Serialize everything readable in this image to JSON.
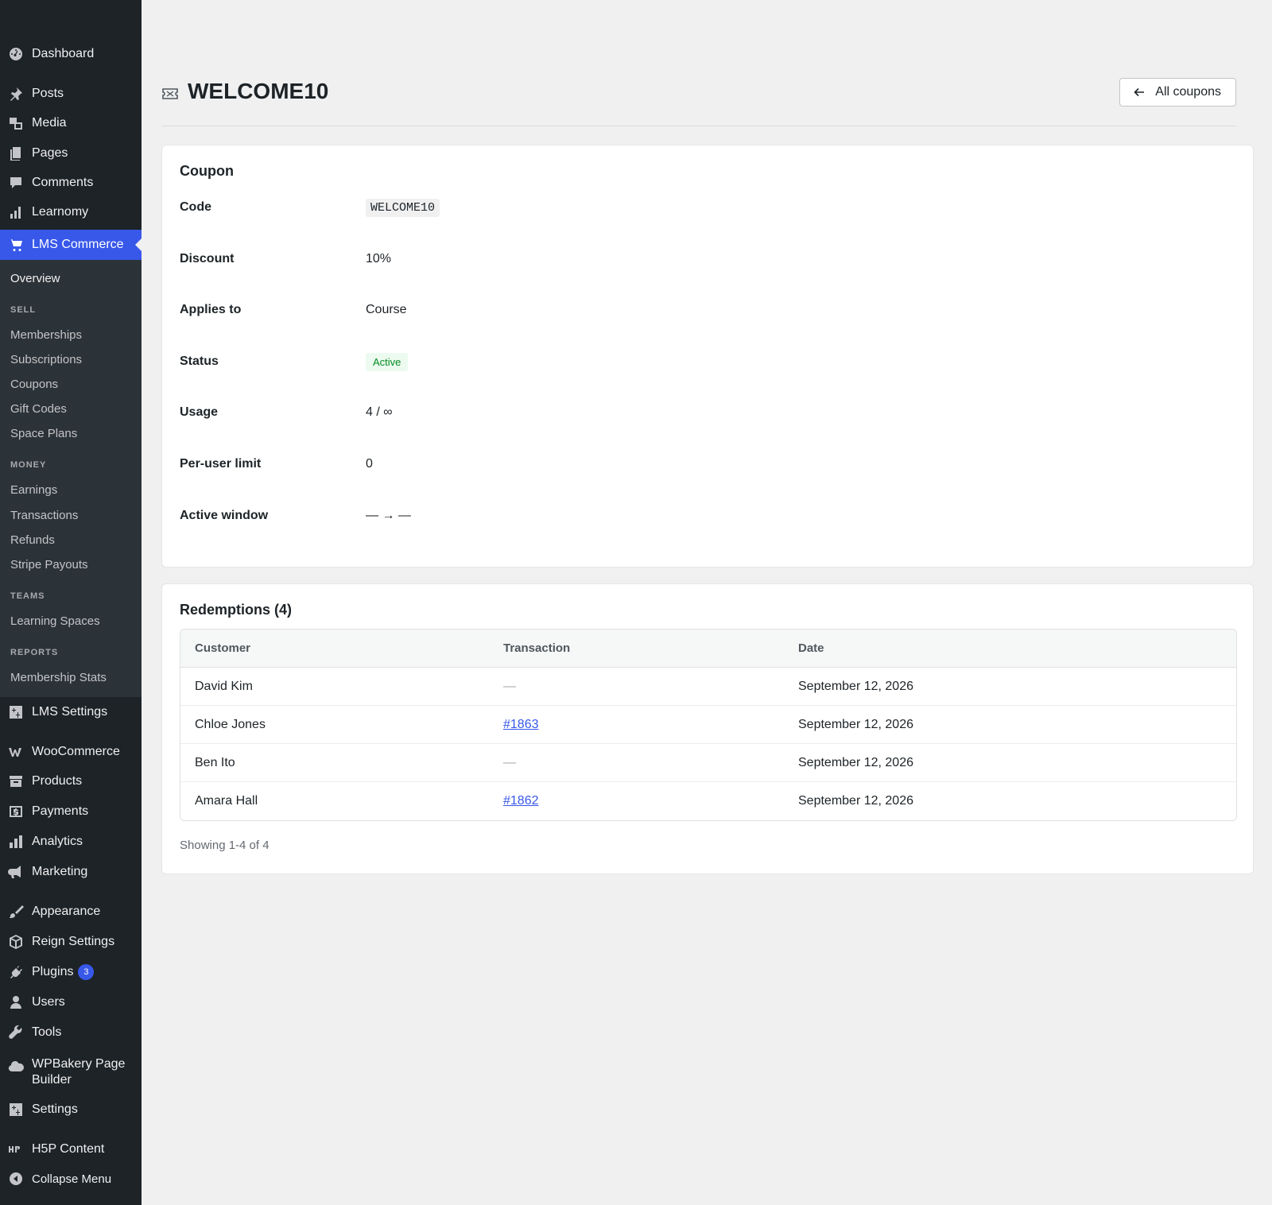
{
  "sidebar": {
    "menu": [
      {
        "label": "Dashboard",
        "icon": "dashboard-icon"
      },
      {
        "label": "Posts",
        "icon": "pin-icon"
      },
      {
        "label": "Media",
        "icon": "media-icon"
      },
      {
        "label": "Pages",
        "icon": "pages-icon"
      },
      {
        "label": "Comments",
        "icon": "comment-icon"
      },
      {
        "label": "Learnomy",
        "icon": "bar-chart-icon"
      },
      {
        "label": "LMS Commerce",
        "icon": "cart-icon"
      },
      {
        "label": "LMS Settings",
        "icon": "settings-icon"
      },
      {
        "label": "WooCommerce",
        "icon": "woocommerce-icon"
      },
      {
        "label": "Products",
        "icon": "archive-icon"
      },
      {
        "label": "Payments",
        "icon": "dollar-icon"
      },
      {
        "label": "Analytics",
        "icon": "bar-chart-icon"
      },
      {
        "label": "Marketing",
        "icon": "megaphone-icon"
      },
      {
        "label": "Appearance",
        "icon": "brush-icon"
      },
      {
        "label": "Reign Settings",
        "icon": "cube-icon"
      },
      {
        "label": "Plugins",
        "icon": "plugin-icon",
        "badge": "3"
      },
      {
        "label": "Users",
        "icon": "user-icon"
      },
      {
        "label": "Tools",
        "icon": "wrench-icon"
      },
      {
        "label": "WPBakery Page Builder",
        "icon": "cloud-icon"
      },
      {
        "label": "Settings",
        "icon": "settings-icon"
      },
      {
        "label": "H5P Content",
        "icon": "h5p-icon"
      },
      {
        "label": "Collapse Menu",
        "icon": "collapse-icon"
      }
    ],
    "submenu": {
      "overview": "Overview",
      "sell_heading": "SELL",
      "sell": [
        "Memberships",
        "Subscriptions",
        "Coupons",
        "Gift Codes",
        "Space Plans"
      ],
      "money_heading": "MONEY",
      "money": [
        "Earnings",
        "Transactions",
        "Refunds",
        "Stripe Payouts"
      ],
      "teams_heading": "TEAMS",
      "teams": [
        "Learning Spaces"
      ],
      "reports_heading": "REPORTS",
      "reports": [
        "Membership Stats"
      ]
    }
  },
  "header": {
    "title": "WELCOME10",
    "back_button": "All coupons"
  },
  "coupon": {
    "title": "Coupon",
    "fields": [
      {
        "label": "Code",
        "value": "WELCOME10"
      },
      {
        "label": "Discount",
        "value": "10%"
      },
      {
        "label": "Applies to",
        "value": "Course"
      },
      {
        "label": "Status",
        "value": "Active"
      },
      {
        "label": "Usage",
        "value": "4 / ∞"
      },
      {
        "label": "Per-user limit",
        "value": "0"
      },
      {
        "label": "Active window",
        "value": "— → —"
      }
    ]
  },
  "redemptions": {
    "title": "Redemptions (4)",
    "columns": [
      "Customer",
      "Transaction",
      "Date"
    ],
    "rows": [
      {
        "customer": "David Kim",
        "transaction": "—",
        "date": "September 12, 2026"
      },
      {
        "customer": "Chloe Jones",
        "transaction": "#1863",
        "date": "September 12, 2026"
      },
      {
        "customer": "Ben Ito",
        "transaction": "—",
        "date": "September 12, 2026"
      },
      {
        "customer": "Amara Hall",
        "transaction": "#1862",
        "date": "September 12, 2026"
      }
    ],
    "showing": "Showing 1-4 of 4"
  },
  "colors": {
    "sidebar_bg": "#1d2327",
    "accent": "#3858e9",
    "status_active": "#008a20"
  }
}
